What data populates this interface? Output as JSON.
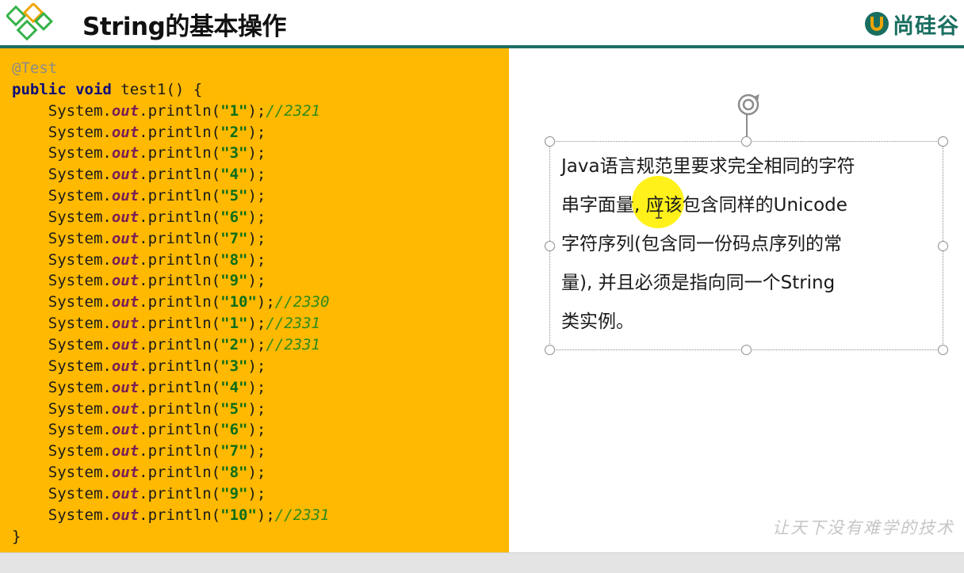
{
  "header": {
    "title": "String的基本操作",
    "brand": "尚硅谷",
    "colors": {
      "accent": "#1f6f63",
      "logo_green": "#35b24a",
      "logo_orange": "#f0a400"
    }
  },
  "code": {
    "annotation": "@Test",
    "signature": {
      "kw1": "public",
      "kw2": "void",
      "rest": " test1() {"
    },
    "lines": [
      {
        "arg": "\"1\"",
        "comment": "//2321"
      },
      {
        "arg": "\"2\"",
        "comment": ""
      },
      {
        "arg": "\"3\"",
        "comment": ""
      },
      {
        "arg": "\"4\"",
        "comment": ""
      },
      {
        "arg": "\"5\"",
        "comment": ""
      },
      {
        "arg": "\"6\"",
        "comment": ""
      },
      {
        "arg": "\"7\"",
        "comment": ""
      },
      {
        "arg": "\"8\"",
        "comment": ""
      },
      {
        "arg": "\"9\"",
        "comment": ""
      },
      {
        "arg": "\"10\"",
        "comment": "//2330"
      },
      {
        "arg": "\"1\"",
        "comment": "//2331"
      },
      {
        "arg": "\"2\"",
        "comment": "//2331"
      },
      {
        "arg": "\"3\"",
        "comment": ""
      },
      {
        "arg": "\"4\"",
        "comment": ""
      },
      {
        "arg": "\"5\"",
        "comment": ""
      },
      {
        "arg": "\"6\"",
        "comment": ""
      },
      {
        "arg": "\"7\"",
        "comment": ""
      },
      {
        "arg": "\"8\"",
        "comment": ""
      },
      {
        "arg": "\"9\"",
        "comment": ""
      },
      {
        "arg": "\"10\"",
        "comment": "//2331"
      }
    ],
    "closing": "}",
    "background": "#ffb900"
  },
  "textbox": {
    "lines": [
      "Java语言规范里要求完全相同的字符",
      "串字面量, 应该包含同样的Unicode",
      "字符序列(包含同一份码点序列的常",
      "量), 并且必须是指向同一个String",
      "类实例。"
    ]
  },
  "watermark": "让天下没有难学的技术"
}
